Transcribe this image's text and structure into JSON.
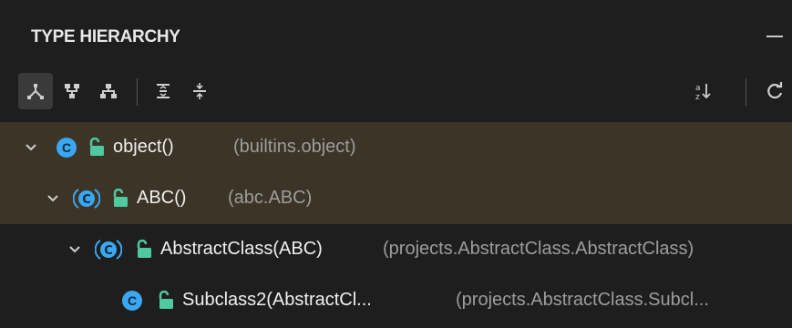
{
  "header": {
    "title": "TYPE HIERARCHY"
  },
  "toolbar": {
    "buttons": [
      {
        "icon": "supertype-hierarchy-icon",
        "active": true
      },
      {
        "icon": "subtype-hierarchy-icon",
        "active": false
      },
      {
        "icon": "type-hierarchy-icon",
        "active": false
      },
      {
        "icon": "expand-all-icon",
        "active": false
      },
      {
        "icon": "collapse-all-icon",
        "active": false
      },
      {
        "icon": "sort-alphabetically-icon",
        "active": false
      },
      {
        "icon": "refresh-icon",
        "active": false
      }
    ]
  },
  "tree": {
    "rows": [
      {
        "name": "object()",
        "detail": "(builtins.object)",
        "kind": "class",
        "expanded": true,
        "selected": true
      },
      {
        "name": "ABC()",
        "detail": "(abc.ABC)",
        "kind": "abstract-class",
        "expanded": true,
        "selected": true
      },
      {
        "name": "AbstractClass(ABC)",
        "detail": "(projects.AbstractClass.AbstractClass)",
        "kind": "abstract-class",
        "expanded": true,
        "selected": false
      },
      {
        "name": "Subclass2(AbstractCl...",
        "detail": "(projects.AbstractClass.Subcl...",
        "kind": "class",
        "expanded": false,
        "selected": false
      }
    ]
  },
  "colors": {
    "background": "#1e1e1e",
    "selection": "#3c3427",
    "class_icon": "#3aa7f0",
    "lock_icon": "#4ec9a0"
  }
}
